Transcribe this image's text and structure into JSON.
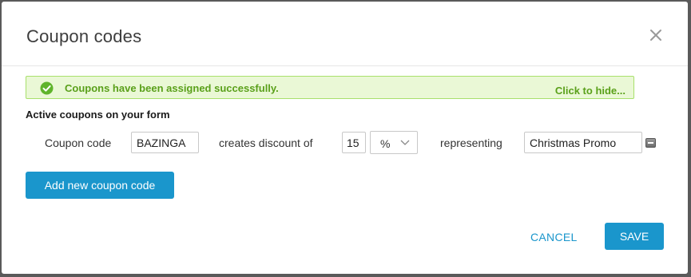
{
  "dialog": {
    "title": "Coupon codes",
    "close_icon": "close-icon"
  },
  "alert": {
    "icon": "check-circle-icon",
    "message": "Coupons have been assigned successfully.",
    "hide_label": "Click to hide..."
  },
  "coupons": {
    "section_title": "Active coupons on your form",
    "row": {
      "code_label": "Coupon code",
      "code_value": "BAZINGA",
      "discount_label": "creates discount of",
      "discount_value": "15",
      "unit_selected": "%",
      "representing_label": "representing",
      "name_value": "Christmas Promo",
      "remove_icon": "remove-icon"
    },
    "add_label": "Add new coupon code"
  },
  "footer": {
    "cancel_label": "CANCEL",
    "save_label": "SAVE"
  },
  "colors": {
    "accent": "#1a96cc",
    "success_bg": "#eaf8d6",
    "success_text": "#5aa01a",
    "backdrop": "#5a5a5a"
  }
}
